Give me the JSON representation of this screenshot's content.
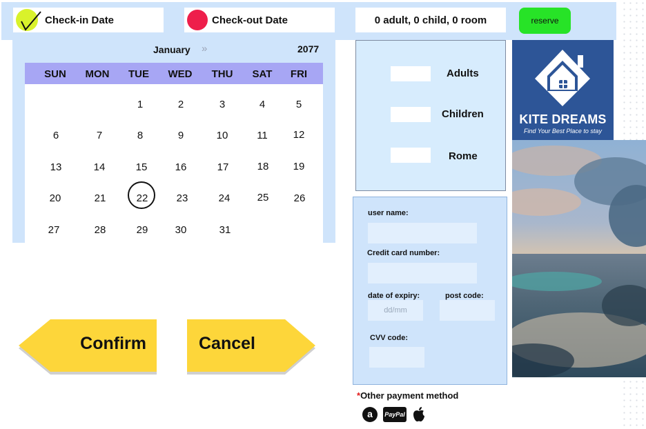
{
  "header": {
    "checkin_label": "Check-in Date",
    "checkout_label": "Check-out Date",
    "guests_summary": "0 adult, 0 child, 0 room",
    "reserve_label": "reserve"
  },
  "calendar": {
    "month": "January",
    "next_icon": "double-chevron-right-icon",
    "year": "2077",
    "weekdays": [
      "SUN",
      "MON",
      "TUE",
      "WED",
      "THU",
      "SAT",
      "FRI"
    ],
    "dates": [
      "1",
      "2",
      "3",
      "4",
      "5",
      "6",
      "7",
      "8",
      "9",
      "10",
      "11",
      "12",
      "13",
      "14",
      "15",
      "16",
      "17",
      "18",
      "19",
      "20",
      "21",
      "22",
      "23",
      "24",
      "25",
      "26",
      "27",
      "28",
      "29",
      "30",
      "31"
    ],
    "selected": "22"
  },
  "actions": {
    "confirm_label": "Confirm",
    "cancel_label": "Cancel"
  },
  "guests": {
    "adults_label": "Adults",
    "children_label": "Children",
    "rooms_label": "Rome"
  },
  "payment": {
    "username_label": "user name:",
    "card_label": "Credit card number:",
    "expiry_label": "date of expiry:",
    "expiry_placeholder": "dd/mm",
    "postcode_label": "post code:",
    "cvv_label": "CVV code:",
    "required_mark": "*",
    "other_methods_label": "Other payment method",
    "methods": [
      "amazon-icon",
      "PayPal",
      "apple-icon"
    ]
  },
  "brand": {
    "name": "KITE DREAMS",
    "tagline": "Find Your Best Place to stay"
  },
  "colors": {
    "panel_blue": "#cfe4fb",
    "week_header": "#a7a6f4",
    "reserve_green": "#27e327",
    "button_yellow": "#fdd63a",
    "brand_blue": "#2d5597",
    "checkin_dot": "#d9f22b",
    "checkout_dot": "#ee1e4b"
  }
}
